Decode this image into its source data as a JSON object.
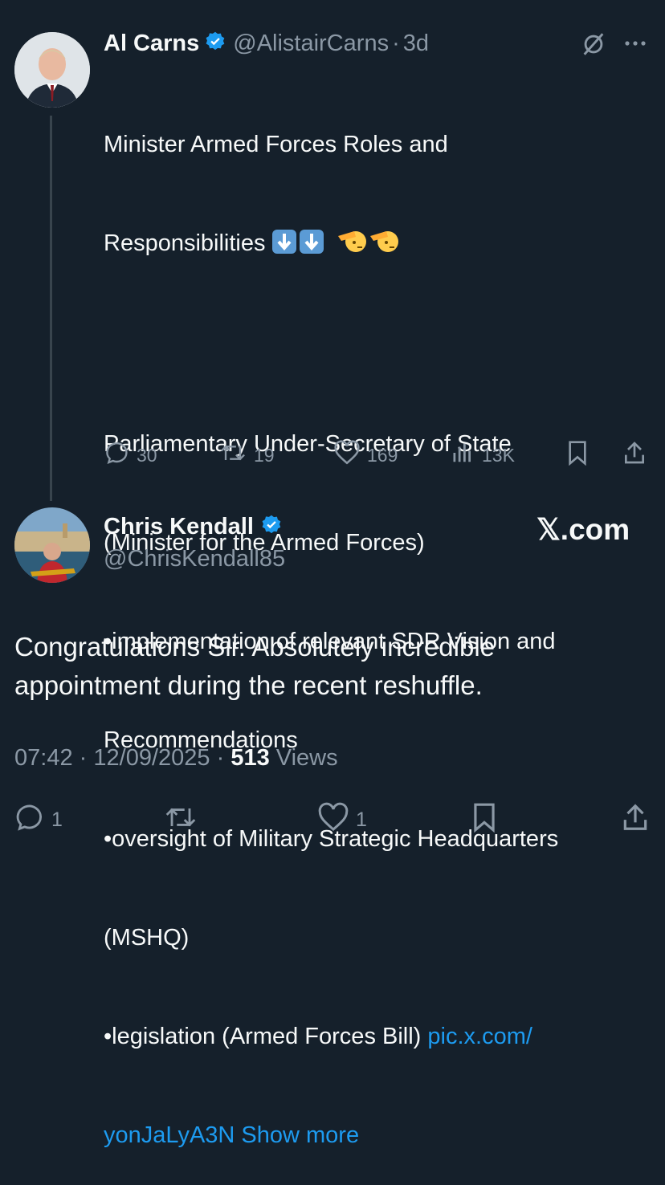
{
  "tweet1": {
    "name": "Al Carns",
    "handle": "@AlistairCarns",
    "separator": "·",
    "time": "3d",
    "line1": "Minister Armed Forces Roles and",
    "line2": "Responsibilities",
    "para2": [
      "Parliamentary Under-Secretary of State",
      "(Minister for the Armed Forces)",
      "•implementation of relevant SDR Vision and",
      "Recommendations",
      "•oversight of Military Strategic Headquarters",
      "(MSHQ)"
    ],
    "last_line_text": "•legislation (Armed Forces Bill) ",
    "link1": "pic.x.com/",
    "link2": "yonJaLyA3N",
    "show_more": "Show more",
    "replies": "30",
    "retweets": "19",
    "likes": "169",
    "views": "13K"
  },
  "tweet2": {
    "name": "Chris Kendall",
    "handle": "@ChrisKendall85",
    "brand": "𝕏.com",
    "text_line1": "Congratulations Sir. Absolutely incredible",
    "text_line2": "appointment during the recent reshuffle.",
    "time": "07:42",
    "date": "12/09/2025",
    "sep1": "·",
    "sep2": "·",
    "views_count": "513",
    "views_label": "Views",
    "replies": "1",
    "likes": "1"
  },
  "colors": {
    "background": "#15202b",
    "accent": "#1d9bf0",
    "muted": "#8b98a5",
    "text": "#f7f9f9"
  }
}
